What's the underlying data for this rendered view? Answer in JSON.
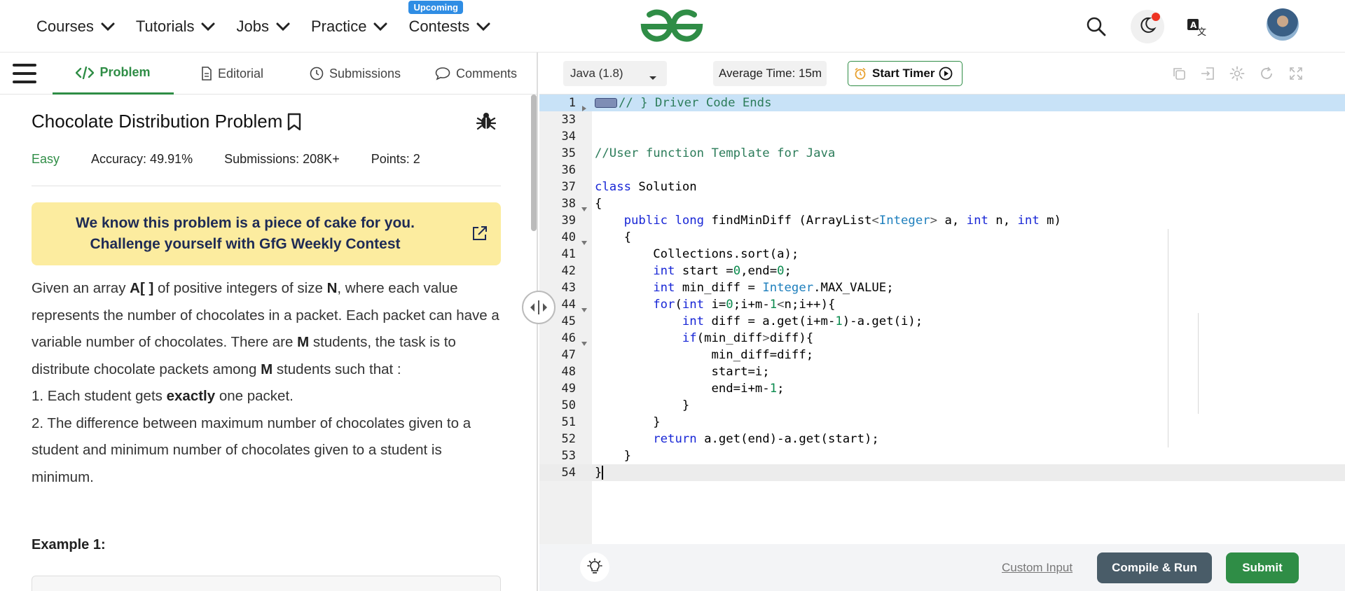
{
  "nav": {
    "items": [
      {
        "label": "Courses"
      },
      {
        "label": "Tutorials"
      },
      {
        "label": "Jobs"
      },
      {
        "label": "Practice"
      },
      {
        "label": "Contests",
        "badge": "Upcoming"
      }
    ],
    "accent_color": "#2f8d46",
    "badge_color": "#2f8de4"
  },
  "tabs": {
    "problem": "Problem",
    "editorial": "Editorial",
    "submissions": "Submissions",
    "comments": "Comments"
  },
  "problem": {
    "title": "Chocolate Distribution Problem",
    "difficulty": "Easy",
    "accuracy": "Accuracy: 49.91%",
    "submissions": "Submissions: 208K+",
    "points": "Points: 2",
    "banner": "We know this problem is a piece of cake for you. Challenge yourself with GfG Weekly Contest",
    "desc_p1_a": "Given an array ",
    "desc_p1_arr": "A[ ]",
    "desc_p1_b": " of positive integers of size ",
    "desc_p1_n": "N",
    "desc_p1_c": ", where each value represents the number of chocolates in a packet. Each packet can have a variable number of chocolates. There are ",
    "desc_p1_m": "M",
    "desc_p1_d": " students, the task is to distribute chocolate packets among ",
    "desc_p1_m2": "M",
    "desc_p1_e": " students such that :",
    "rule1_a": "1. Each student gets ",
    "rule1_b": "exactly",
    "rule1_c": " one packet.",
    "rule2": "2. The difference between maximum number of chocolates given to a student and minimum number of chocolates given to a student is minimum.",
    "example_title": "Example 1:"
  },
  "editor": {
    "language": "Java (1.8)",
    "average_time": "Average Time: 15m",
    "start_timer": "Start Timer",
    "line_numbers": [
      "1",
      "33",
      "34",
      "35",
      "36",
      "37",
      "38",
      "39",
      "40",
      "41",
      "42",
      "43",
      "44",
      "45",
      "46",
      "47",
      "48",
      "49",
      "50",
      "51",
      "52",
      "53",
      "54"
    ]
  },
  "bottom": {
    "custom_input": "Custom Input",
    "compile_run": "Compile & Run",
    "submit": "Submit"
  }
}
